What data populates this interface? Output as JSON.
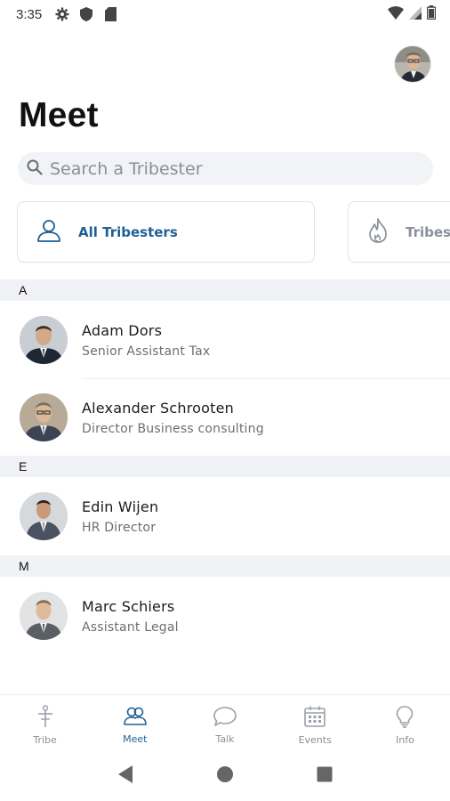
{
  "status_bar": {
    "time": "3:35"
  },
  "header": {
    "title": "Meet"
  },
  "search": {
    "placeholder": "Search a Tribester"
  },
  "filters": [
    {
      "label": "All Tribesters",
      "icon": "person-icon",
      "active": true
    },
    {
      "label": "Tribes",
      "icon": "flame-icon",
      "active": false
    }
  ],
  "sections": [
    {
      "letter": "A",
      "contacts": [
        {
          "name": "Adam Dors",
          "role": "Senior Assistant Tax"
        },
        {
          "name": "Alexander Schrooten",
          "role": "Director Business consulting"
        }
      ]
    },
    {
      "letter": "E",
      "contacts": [
        {
          "name": "Edin Wijen",
          "role": "HR Director"
        }
      ]
    },
    {
      "letter": "M",
      "contacts": [
        {
          "name": "Marc Schiers",
          "role": "Assistant Legal"
        }
      ]
    }
  ],
  "bottom_nav": [
    {
      "label": "Tribe",
      "icon": "tribe-icon"
    },
    {
      "label": "Meet",
      "icon": "people-icon",
      "active": true
    },
    {
      "label": "Talk",
      "icon": "chat-bubble-icon"
    },
    {
      "label": "Events",
      "icon": "calendar-icon"
    },
    {
      "label": "Info",
      "icon": "lightbulb-icon"
    }
  ],
  "colors": {
    "accent": "#1f5f94",
    "muted": "#8a8f99",
    "section_bg": "#f0f2f5",
    "search_bg": "#f1f3f6"
  }
}
